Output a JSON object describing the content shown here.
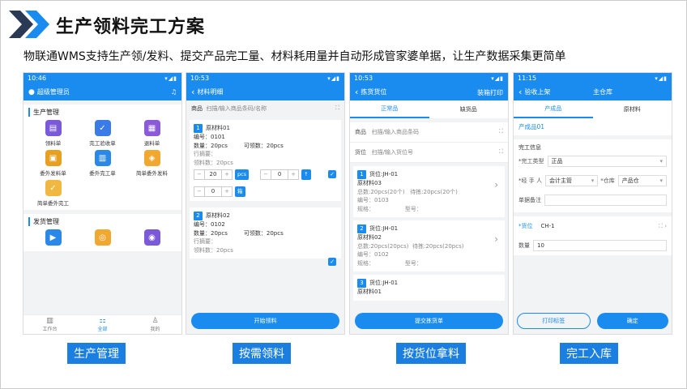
{
  "header": {
    "title": "生产领料完工方案",
    "subtitle": "物联通WMS支持生产领/发料、提交产品完工量、材料耗用量并自动形成管家婆单据，让生产数据采集更简单"
  },
  "captions": [
    "生产管理",
    "按需领料",
    "按货位拿料",
    "完工入库"
  ],
  "phone1": {
    "time": "10:46",
    "user": "超级管理员",
    "section1": "生产管理",
    "items1": [
      "领料单",
      "完工验收单",
      "退料单",
      "委外发料单",
      "委外完工单",
      "简单委外发料",
      "简单委外完工"
    ],
    "section2": "发货管理",
    "tabs": [
      "工作台",
      "全部",
      "我的"
    ]
  },
  "phone2": {
    "time": "10:53",
    "nav_title": "材料明细",
    "search_label": "商品",
    "search_placeholder": "扫描/输入商品条码/名称",
    "card1": {
      "no": "1",
      "name": "原材料01",
      "code": "编号：0101",
      "qty": "数量：20pcs",
      "avail": "可领数：20pcs",
      "row": "行摘要：",
      "picked": "领料数：20pcs",
      "v1": "20",
      "v2": "0",
      "v3": "0",
      "btn_pcs": "pcs",
      "btn_box": "箱"
    },
    "card2": {
      "no": "2",
      "name": "原材料02",
      "code": "编号：0102",
      "qty": "数量：20pcs",
      "avail": "可领数：20pcs",
      "row": "行摘要：",
      "picked": "领料数：20pcs"
    },
    "button": "开始领料"
  },
  "phone3": {
    "time": "10:53",
    "nav_title": "拣货货位",
    "nav_right": "装箱打印",
    "tab_on": "正常品",
    "tab_off": "缺货品",
    "row1_label": "商品",
    "row1_ph": "扫描/输入商品条码",
    "row2_label": "货位",
    "row2_ph": "扫描/输入货位号",
    "cards": [
      {
        "no": "1",
        "loc": "货位:JH-01",
        "mat": "原材料03",
        "total": "总数:20pcs(20个)",
        "pick": "待拣:20pcs(20个)",
        "code": "编号：0103",
        "spec": "规格：",
        "model": "型号："
      },
      {
        "no": "2",
        "loc": "货位:JH-01",
        "mat": "原材料02",
        "total": "总数:20pcs(20pcs)",
        "pick": "待拣:20pcs(20pcs)",
        "code": "编号：0102",
        "spec": "规格：",
        "model": "型号："
      },
      {
        "no": "3",
        "loc": "货位:JH-01",
        "mat": "原材料01"
      }
    ],
    "button": "提交拣货单"
  },
  "phone4": {
    "time": "11:15",
    "nav_title": "验收上架",
    "nav_right": "主仓库",
    "tab_on": "产成品",
    "tab_off": "原材料",
    "product": "产成品01",
    "info_title": "完工信息",
    "type_label": "*完工类型",
    "type_val": "正品",
    "handler_label": "*经 手 人",
    "handler_val": "会计主管",
    "wh_label": "*仓库",
    "wh_val": "产品仓",
    "note_label": "单据备注",
    "loc_label": "*货位",
    "loc_val": "CH-1",
    "qty_label": "数量",
    "qty_val": "10",
    "btn_print": "打印标签",
    "btn_ok": "确定"
  }
}
